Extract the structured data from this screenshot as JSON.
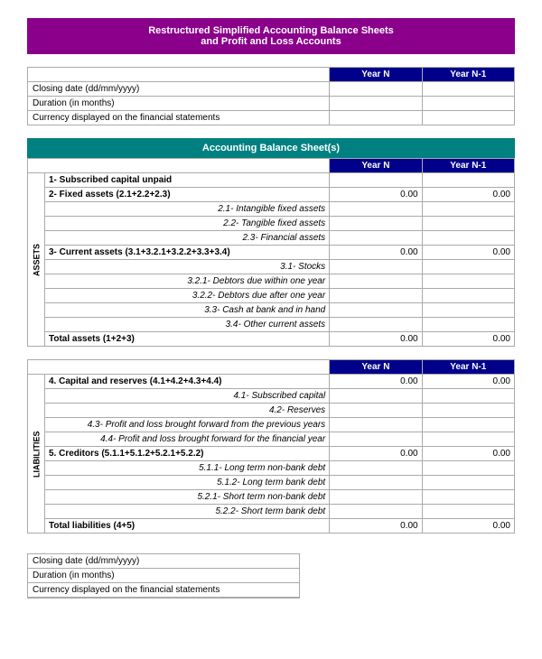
{
  "title": {
    "line1": "Restructured Simplified Accounting Balance Sheets",
    "line2": "and Profit and Loss Accounts"
  },
  "topInfo": {
    "headers": {
      "yearN": "Year N",
      "yearN1": "Year N-1"
    },
    "rows": [
      {
        "label": "Closing date (dd/mm/yyyy)"
      },
      {
        "label": "Duration (in months)"
      },
      {
        "label": "Currency displayed on the financial statements"
      }
    ]
  },
  "balanceSheet": {
    "title": "Accounting Balance Sheet(s)",
    "headers": {
      "yearN": "Year N",
      "yearN1": "Year N-1"
    },
    "assetsLabel": "ASSETS",
    "liabilitiesLabel": "LIABILITIES",
    "assetsRows": [
      {
        "type": "bold",
        "label": "1- Subscribed capital unpaid",
        "yearN": "",
        "yearN1": ""
      },
      {
        "type": "bold",
        "label": "2- Fixed assets (2.1+2.2+2.3)",
        "yearN": "0.00",
        "yearN1": "0.00"
      },
      {
        "type": "italic-right",
        "label": "2.1- Intangible fixed assets",
        "yearN": "",
        "yearN1": ""
      },
      {
        "type": "italic-right",
        "label": "2.2- Tangible fixed assets",
        "yearN": "",
        "yearN1": ""
      },
      {
        "type": "italic-right",
        "label": "2.3- Financial assets",
        "yearN": "",
        "yearN1": ""
      },
      {
        "type": "bold",
        "label": "3- Current assets (3.1+3.2.1+3.2.2+3.3+3.4)",
        "yearN": "0.00",
        "yearN1": "0.00"
      },
      {
        "type": "italic-right",
        "label": "3.1- Stocks",
        "yearN": "",
        "yearN1": ""
      },
      {
        "type": "italic-right",
        "label": "3.2.1- Debtors due within one year",
        "yearN": "",
        "yearN1": ""
      },
      {
        "type": "italic-right",
        "label": "3.2.2- Debtors due after one year",
        "yearN": "",
        "yearN1": ""
      },
      {
        "type": "italic-right",
        "label": "3.3- Cash at bank and in hand",
        "yearN": "",
        "yearN1": ""
      },
      {
        "type": "italic-right",
        "label": "3.4- Other current assets",
        "yearN": "",
        "yearN1": ""
      },
      {
        "type": "total",
        "label": "Total assets (1+2+3)",
        "yearN": "0.00",
        "yearN1": "0.00"
      }
    ],
    "liabilitiesRows": [
      {
        "type": "bold",
        "label": "4. Capital and reserves (4.1+4.2+4.3+4.4)",
        "yearN": "0.00",
        "yearN1": "0.00"
      },
      {
        "type": "italic-right",
        "label": "4.1- Subscribed capital",
        "yearN": "",
        "yearN1": ""
      },
      {
        "type": "italic-right",
        "label": "4.2- Reserves",
        "yearN": "",
        "yearN1": ""
      },
      {
        "type": "italic-right",
        "label": "4.3- Profit and loss brought forward from the previous years",
        "yearN": "",
        "yearN1": ""
      },
      {
        "type": "italic-right",
        "label": "4.4- Profit and loss brought forward for the financial year",
        "yearN": "",
        "yearN1": ""
      },
      {
        "type": "bold",
        "label": "5. Creditors (5.1.1+5.1.2+5.2.1+5.2.2)",
        "yearN": "0.00",
        "yearN1": "0.00"
      },
      {
        "type": "italic-right",
        "label": "5.1.1- Long term non-bank debt",
        "yearN": "",
        "yearN1": ""
      },
      {
        "type": "italic-right",
        "label": "5.1.2- Long term bank debt",
        "yearN": "",
        "yearN1": ""
      },
      {
        "type": "italic-right",
        "label": "5.2.1- Short term non-bank debt",
        "yearN": "",
        "yearN1": ""
      },
      {
        "type": "italic-right",
        "label": "5.2.2- Short term bank debt",
        "yearN": "",
        "yearN1": ""
      },
      {
        "type": "total",
        "label": "Total liabilities (4+5)",
        "yearN": "0.00",
        "yearN1": "0.00"
      }
    ]
  },
  "bottomInfo": {
    "rows": [
      {
        "label": "Closing date (dd/mm/yyyy)"
      },
      {
        "label": "Duration (in months)"
      },
      {
        "label": "Currency displayed on the financial statements"
      }
    ]
  }
}
